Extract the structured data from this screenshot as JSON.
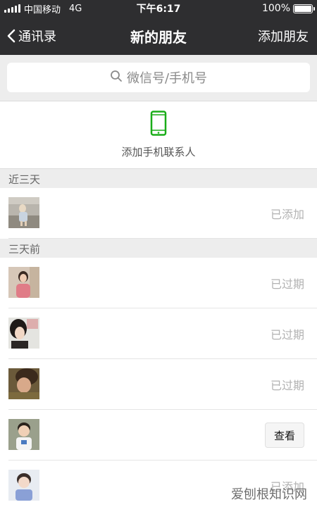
{
  "status_bar": {
    "carrier": "中国移动",
    "network": "4G",
    "time": "下午6:17",
    "battery_text": "100%",
    "battery_level": 1.0
  },
  "nav": {
    "back_label": "通讯录",
    "title": "新的朋友",
    "action_label": "添加朋友"
  },
  "search": {
    "placeholder": "微信号/手机号"
  },
  "add_phone": {
    "label": "添加手机联系人",
    "icon": "mobile-phone-icon",
    "icon_color": "#1aad19"
  },
  "sections": [
    {
      "title": "近三天",
      "items": [
        {
          "status": "已添加",
          "type": "text"
        }
      ]
    },
    {
      "title": "三天前",
      "items": [
        {
          "status": "已过期",
          "type": "text"
        },
        {
          "status": "已过期",
          "type": "text"
        },
        {
          "status": "已过期",
          "type": "text"
        },
        {
          "status": "查看",
          "type": "button"
        },
        {
          "status": "已添加",
          "type": "text"
        }
      ]
    }
  ],
  "watermark": "爱刨根知识网",
  "colors": {
    "header_bg": "#2e2e30",
    "page_bg": "#ededed",
    "status_gray": "#b2b2b2",
    "accent_green": "#1aad19"
  }
}
